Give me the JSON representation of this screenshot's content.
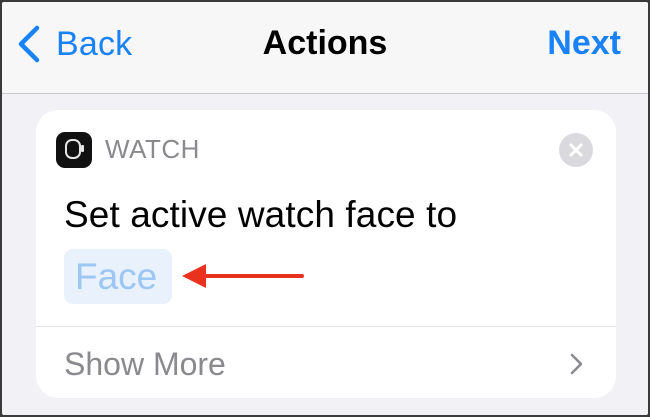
{
  "navbar": {
    "back_label": "Back",
    "title": "Actions",
    "next_label": "Next"
  },
  "action_card": {
    "app_name": "WATCH",
    "app_icon": "watch-icon",
    "action_text": "Set active watch face to",
    "parameter": "Face",
    "show_more_label": "Show More"
  },
  "colors": {
    "accent": "#1a82f7",
    "annotation_arrow": "#e8321e"
  }
}
